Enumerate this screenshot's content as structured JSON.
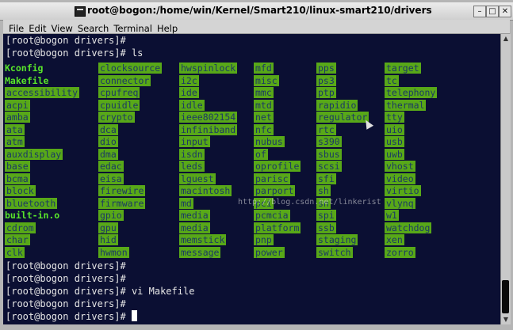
{
  "window": {
    "title": "root@bogon:/home/win/Kernel/Smart210/linux-smart210/drivers",
    "minimize_glyph": "–",
    "maximize_glyph": "□",
    "close_glyph": "✕"
  },
  "menu": [
    "File",
    "Edit",
    "View",
    "Search",
    "Terminal",
    "Help"
  ],
  "terminal": {
    "lines_top": [
      "[root@bogon drivers]#",
      "[root@bogon drivers]# ls"
    ],
    "lines_bottom": [
      "[root@bogon drivers]#",
      "[root@bogon drivers]#",
      "[root@bogon drivers]# vi Makefile",
      "[root@bogon drivers]#",
      "[root@bogon drivers]# "
    ],
    "ls_columns": [
      [
        {
          "name": "Kconfig",
          "kind": "file"
        },
        {
          "name": "Makefile",
          "kind": "file"
        },
        {
          "name": "accessibility",
          "kind": "dir"
        },
        {
          "name": "acpi",
          "kind": "dir"
        },
        {
          "name": "amba",
          "kind": "dir"
        },
        {
          "name": "ata",
          "kind": "dir"
        },
        {
          "name": "atm",
          "kind": "dir"
        },
        {
          "name": "auxdisplay",
          "kind": "dir"
        },
        {
          "name": "base",
          "kind": "dir"
        },
        {
          "name": "bcma",
          "kind": "dir"
        },
        {
          "name": "block",
          "kind": "dir"
        },
        {
          "name": "bluetooth",
          "kind": "dir"
        },
        {
          "name": "built-in.o",
          "kind": "file"
        },
        {
          "name": "cdrom",
          "kind": "dir"
        },
        {
          "name": "char",
          "kind": "dir"
        },
        {
          "name": "clk",
          "kind": "dir"
        }
      ],
      [
        {
          "name": "clocksource",
          "kind": "dir"
        },
        {
          "name": "connector",
          "kind": "dir"
        },
        {
          "name": "cpufreq",
          "kind": "dir"
        },
        {
          "name": "cpuidle",
          "kind": "dir"
        },
        {
          "name": "crypto",
          "kind": "dir"
        },
        {
          "name": "dca",
          "kind": "dir"
        },
        {
          "name": "dio",
          "kind": "dir"
        },
        {
          "name": "dma",
          "kind": "dir"
        },
        {
          "name": "edac",
          "kind": "dir"
        },
        {
          "name": "eisa",
          "kind": "dir"
        },
        {
          "name": "firewire",
          "kind": "dir"
        },
        {
          "name": "firmware",
          "kind": "dir"
        },
        {
          "name": "gpio",
          "kind": "dir"
        },
        {
          "name": "gpu",
          "kind": "dir"
        },
        {
          "name": "hid",
          "kind": "dir"
        },
        {
          "name": "hwmon",
          "kind": "dir"
        }
      ],
      [
        {
          "name": "hwspinlock",
          "kind": "dir"
        },
        {
          "name": "i2c",
          "kind": "dir"
        },
        {
          "name": "ide",
          "kind": "dir"
        },
        {
          "name": "idle",
          "kind": "dir"
        },
        {
          "name": "ieee802154",
          "kind": "dir"
        },
        {
          "name": "infiniband",
          "kind": "dir"
        },
        {
          "name": "input",
          "kind": "dir"
        },
        {
          "name": "isdn",
          "kind": "dir"
        },
        {
          "name": "leds",
          "kind": "dir"
        },
        {
          "name": "lguest",
          "kind": "dir"
        },
        {
          "name": "macintosh",
          "kind": "dir"
        },
        {
          "name": "md",
          "kind": "dir"
        },
        {
          "name": "media",
          "kind": "dir"
        },
        {
          "name": "media",
          "kind": "dir"
        },
        {
          "name": "memstick",
          "kind": "dir"
        },
        {
          "name": "message",
          "kind": "dir"
        }
      ],
      [
        {
          "name": "mfd",
          "kind": "dir"
        },
        {
          "name": "misc",
          "kind": "dir"
        },
        {
          "name": "mmc",
          "kind": "dir"
        },
        {
          "name": "mtd",
          "kind": "dir"
        },
        {
          "name": "net",
          "kind": "dir"
        },
        {
          "name": "nfc",
          "kind": "dir"
        },
        {
          "name": "nubus",
          "kind": "dir"
        },
        {
          "name": "of",
          "kind": "dir"
        },
        {
          "name": "oprofile",
          "kind": "dir"
        },
        {
          "name": "parisc",
          "kind": "dir"
        },
        {
          "name": "parport",
          "kind": "dir"
        },
        {
          "name": "pci",
          "kind": "dir"
        },
        {
          "name": "pcmcia",
          "kind": "dir"
        },
        {
          "name": "platform",
          "kind": "dir"
        },
        {
          "name": "pnp",
          "kind": "dir"
        },
        {
          "name": "power",
          "kind": "dir"
        }
      ],
      [
        {
          "name": "pps",
          "kind": "dir"
        },
        {
          "name": "ps3",
          "kind": "dir"
        },
        {
          "name": "ptp",
          "kind": "dir"
        },
        {
          "name": "rapidio",
          "kind": "dir"
        },
        {
          "name": "regulator",
          "kind": "dir"
        },
        {
          "name": "rtc",
          "kind": "dir"
        },
        {
          "name": "s390",
          "kind": "dir"
        },
        {
          "name": "sbus",
          "kind": "dir"
        },
        {
          "name": "scsi",
          "kind": "dir"
        },
        {
          "name": "sfi",
          "kind": "dir"
        },
        {
          "name": "sh",
          "kind": "dir"
        },
        {
          "name": "sn",
          "kind": "dir"
        },
        {
          "name": "spi",
          "kind": "dir"
        },
        {
          "name": "ssb",
          "kind": "dir"
        },
        {
          "name": "staging",
          "kind": "dir"
        },
        {
          "name": "switch",
          "kind": "dir"
        }
      ],
      [
        {
          "name": "target",
          "kind": "dir"
        },
        {
          "name": "tc",
          "kind": "dir"
        },
        {
          "name": "telephony",
          "kind": "dir"
        },
        {
          "name": "thermal",
          "kind": "dir"
        },
        {
          "name": "tty",
          "kind": "dir"
        },
        {
          "name": "uio",
          "kind": "dir"
        },
        {
          "name": "usb",
          "kind": "dir"
        },
        {
          "name": "uwb",
          "kind": "dir"
        },
        {
          "name": "vhost",
          "kind": "dir"
        },
        {
          "name": "video",
          "kind": "dir"
        },
        {
          "name": "virtio",
          "kind": "dir"
        },
        {
          "name": "vlynq",
          "kind": "dir"
        },
        {
          "name": "w1",
          "kind": "dir"
        },
        {
          "name": "watchdog",
          "kind": "dir"
        },
        {
          "name": "xen",
          "kind": "dir"
        },
        {
          "name": "zorro",
          "kind": "dir"
        }
      ]
    ],
    "watermark": "http://blog.csdn.net/linkerist"
  },
  "colors": {
    "terminal_bg": "#0b0f33",
    "dir_highlight": "#58a818",
    "dir_text": "#1c3a63",
    "file_text": "#59e62a",
    "prompt_text": "#e6e6e6"
  }
}
